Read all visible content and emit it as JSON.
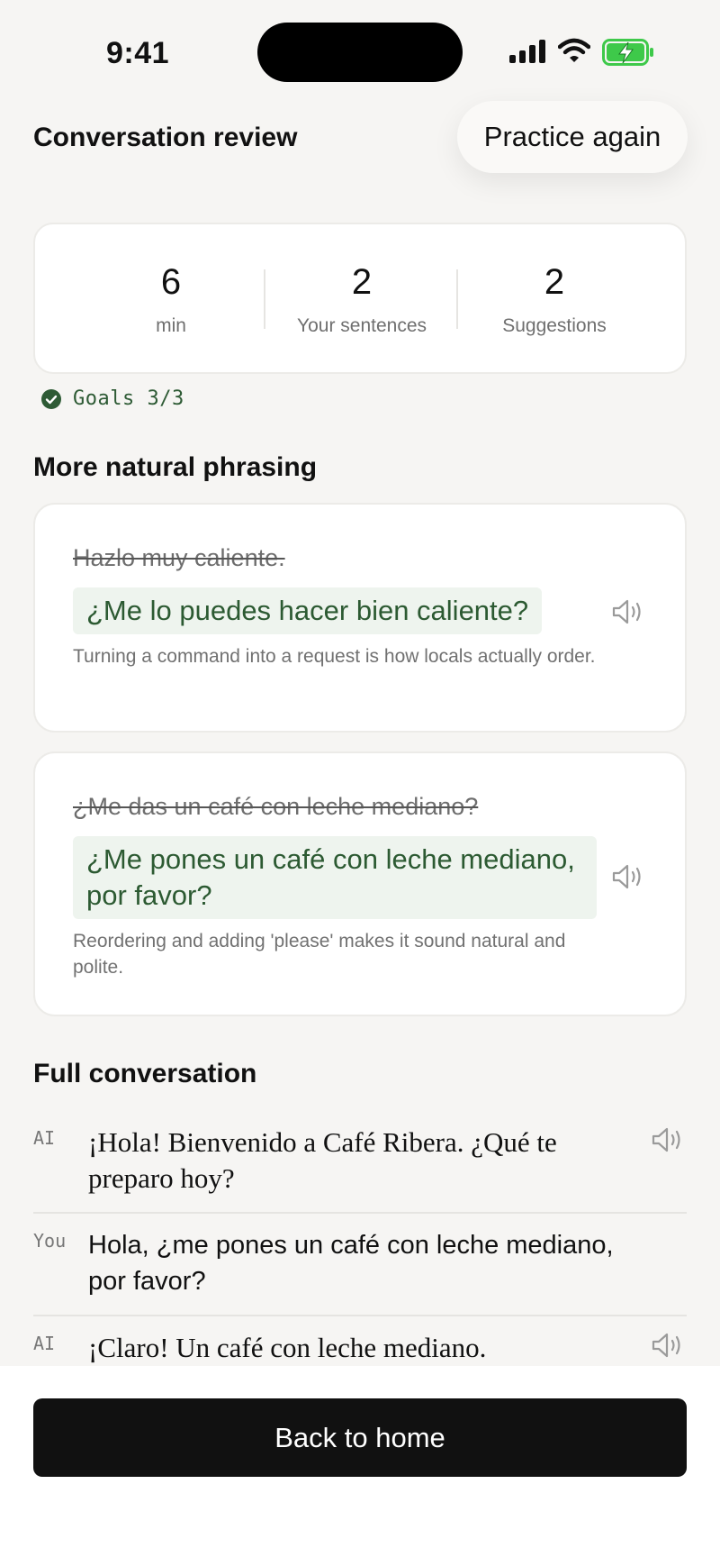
{
  "status_bar": {
    "time": "9:41"
  },
  "header": {
    "title": "Conversation review",
    "practice_label": "Practice again"
  },
  "stats": [
    {
      "value": "6",
      "label": "min"
    },
    {
      "value": "2",
      "label": "Your sentences"
    },
    {
      "value": "2",
      "label": "Suggestions"
    }
  ],
  "goals": {
    "text": "Goals 3/3"
  },
  "phrasing": {
    "title": "More natural phrasing",
    "suggestions": [
      {
        "original": "Hazlo muy caliente.",
        "better": "¿Me lo puedes hacer bien caliente?",
        "note": "Turning a command into a request is how locals actually order."
      },
      {
        "original": "¿Me das un café con leche mediano?",
        "better": "¿Me pones un café con leche mediano, por favor?",
        "note": "Reordering and adding 'please' makes it sound natural and polite."
      }
    ]
  },
  "conversation": {
    "title": "Full conversation",
    "messages": [
      {
        "speaker": "AI",
        "text": "¡Hola! Bienvenido a Café Ribera. ¿Qué te preparo hoy?"
      },
      {
        "speaker": "You",
        "text": "Hola, ¿me pones un café con leche mediano, por favor?"
      },
      {
        "speaker": "AI",
        "text": "¡Claro! Un café con leche mediano."
      }
    ]
  },
  "footer": {
    "back_label": "Back to home"
  },
  "colors": {
    "accent_green": "#2c5a32",
    "suggestion_bg": "#eef4ee",
    "button_dark": "#111111",
    "battery_green": "#3ec94a"
  }
}
